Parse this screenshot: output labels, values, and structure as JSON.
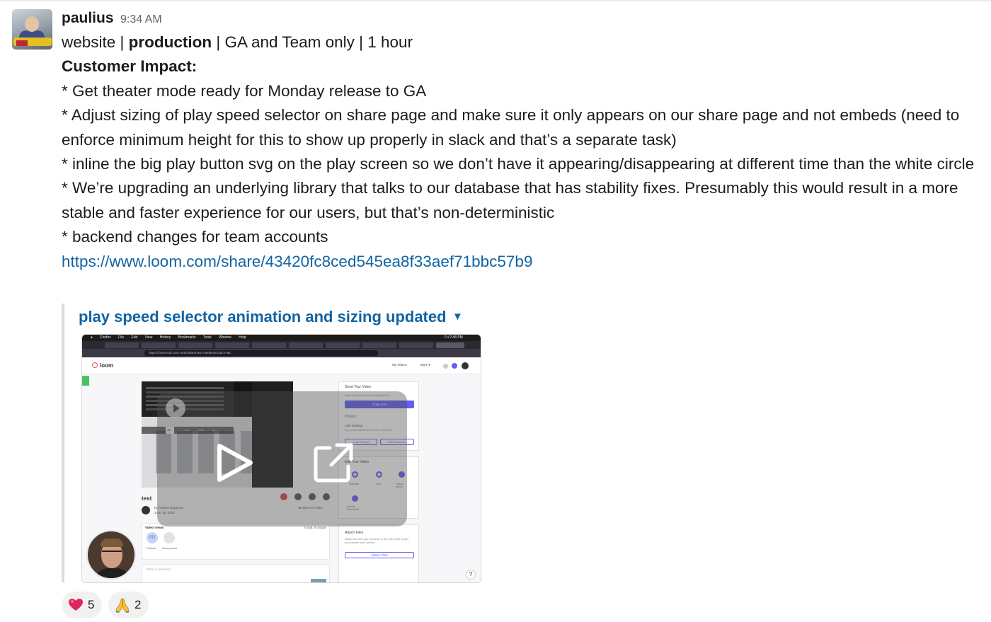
{
  "message": {
    "author": "paulius",
    "time": "9:34 AM",
    "line1": {
      "pre": "website | ",
      "bold": "production",
      "post": " | GA and Team only | 1 hour"
    },
    "impact_heading": "Customer Impact:",
    "bullets": [
      "* Get theater mode ready for Monday release to GA",
      "* Adjust sizing of play speed selector on share page and make sure it only appears on our share page and not embeds (need to enforce minimum height for this to show up properly in slack and that’s a separate task)",
      "* inline the big play button svg on the play screen so we don’t have it appearing/disappearing at different time than the white circle",
      "* We’re upgrading an underlying library that talks to our database that has stability fixes. Presumably this would result in a more stable and faster experience for our users, but that’s non-deterministic",
      "* backend changes for team accounts"
    ],
    "link": "https://www.loom.com/share/43420fc8ced545ea8f33aef71bbc57b9"
  },
  "attachment": {
    "title": "play speed selector animation and sizing updated",
    "caret": "▼",
    "preview": {
      "menubar": [
        "Firefox",
        "File",
        "Edit",
        "View",
        "History",
        "Bookmarks",
        "Tools",
        "Window",
        "Help"
      ],
      "clock": "Fri 2:48 PM",
      "url": "https://loomlocal.com:4444/share/3e17c5af5ea743dc2784...",
      "logo": "loom",
      "nav": [
        "My Videos",
        "More ▾"
      ],
      "video_title": "test",
      "owner": "by Paulius Dragunas",
      "date": "June 15, 2019",
      "views_label": "Video Views",
      "views_count": "6 total, 5 unique",
      "viewer1": "Paulius",
      "viewer2": "Anonymous",
      "viewer_initials": "PD",
      "comment_placeholder": "Write a comment",
      "send_heading": "Send Your Video",
      "share_url": "https://loomlocal.com:4444/share/3...",
      "copy_link": "Copy Link",
      "privacy": "Privacy",
      "link_sharing": "Link Sharing",
      "link_sharing_desc": "Any people with the link can see your video",
      "invite": "Invite People",
      "add_password": "Add Password",
      "edit_heading": "Edit Your Video",
      "edit_actions": [
        "Settings",
        "Trim",
        "Call-to-action"
      ],
      "custom_thumb": "Custom Thumbnail",
      "attach_heading": "Attach Files",
      "attach_desc": "Attach files from your computer or link with a URL to give your viewers more context.",
      "attach_button": "Attach Files",
      "speeds": [
        "1x",
        "1.2x",
        "1.5x",
        "2x"
      ],
      "help": "?"
    }
  },
  "reactions": [
    {
      "emoji": "heart-emoji",
      "count": "5"
    },
    {
      "emoji": "folded-hands-emoji",
      "count": "2"
    }
  ],
  "colors": {
    "link": "#1264a3",
    "reaction_bg": "#f1f1f1",
    "attachment_border": "#dddddd"
  }
}
